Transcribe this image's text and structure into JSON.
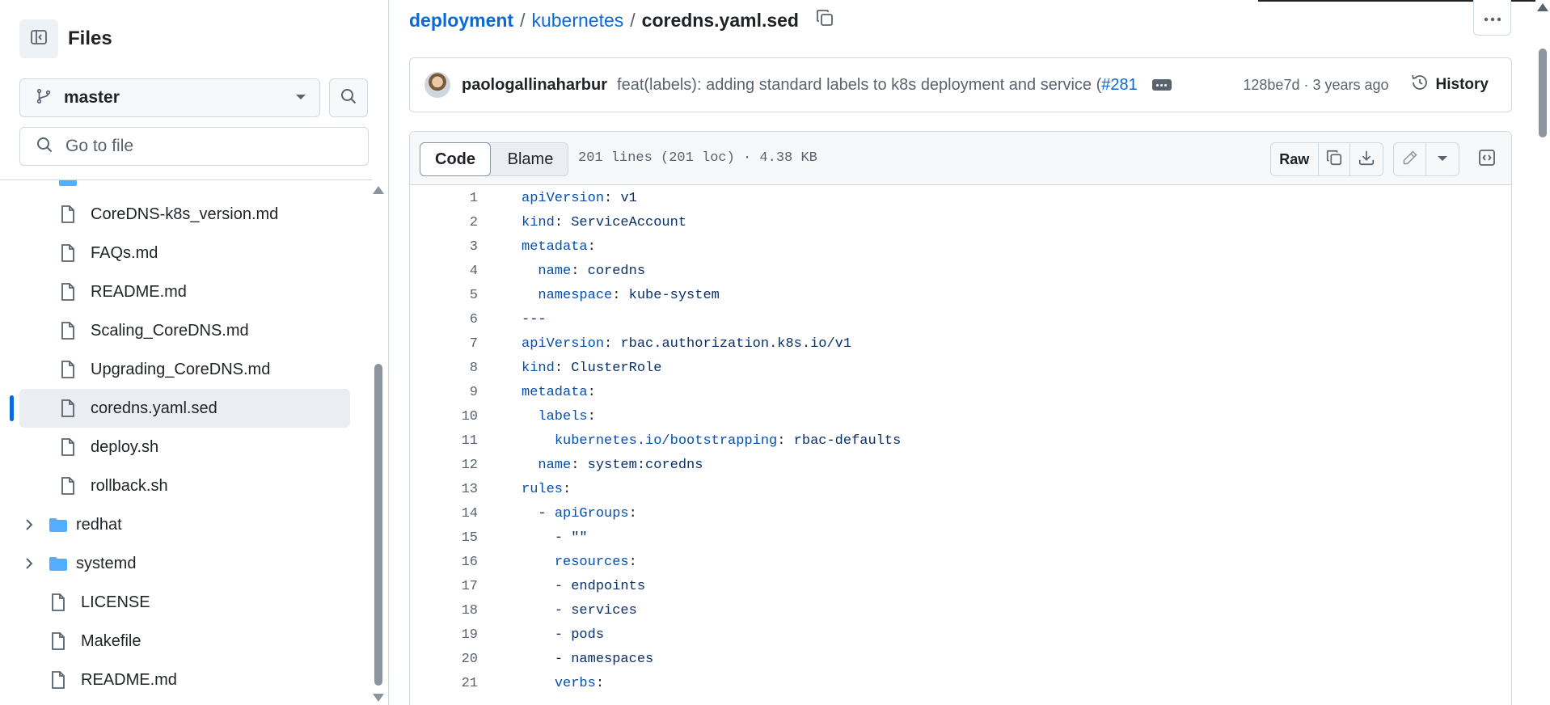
{
  "sidebar": {
    "title": "Files",
    "branch": "master",
    "goto_placeholder": "Go to file",
    "items": [
      {
        "label": "CoreDNS-k8s_version.md",
        "type": "file"
      },
      {
        "label": "FAQs.md",
        "type": "file"
      },
      {
        "label": "README.md",
        "type": "file"
      },
      {
        "label": "Scaling_CoreDNS.md",
        "type": "file"
      },
      {
        "label": "Upgrading_CoreDNS.md",
        "type": "file"
      },
      {
        "label": "coredns.yaml.sed",
        "type": "file",
        "active": true
      },
      {
        "label": "deploy.sh",
        "type": "file"
      },
      {
        "label": "rollback.sh",
        "type": "file"
      },
      {
        "label": "redhat",
        "type": "folder"
      },
      {
        "label": "systemd",
        "type": "folder"
      },
      {
        "label": "LICENSE",
        "type": "file"
      },
      {
        "label": "Makefile",
        "type": "file"
      },
      {
        "label": "README.md",
        "type": "file"
      }
    ]
  },
  "breadcrumb": {
    "root": "deployment",
    "sep": "/",
    "dir": "kubernetes",
    "file": "coredns.yaml.sed"
  },
  "commit": {
    "author": "paologallinaharbur",
    "message": "feat(labels): adding standard labels to k8s deployment and service (",
    "pr": "#281",
    "hash": "128be7d",
    "time": "3 years ago",
    "meta": "128be7d · 3 years ago",
    "history_label": "History"
  },
  "file": {
    "tab_code": "Code",
    "tab_blame": "Blame",
    "info": "201 lines (201 loc) · 4.38 KB",
    "raw_label": "Raw",
    "lines": [
      {
        "n": "1",
        "k": "apiVersion",
        "v": "v1",
        "indent": ""
      },
      {
        "n": "2",
        "k": "kind",
        "v": "ServiceAccount",
        "indent": ""
      },
      {
        "n": "3",
        "k": "metadata",
        "v": "",
        "indent": ""
      },
      {
        "n": "4",
        "k": "name",
        "v": "coredns",
        "indent": "  "
      },
      {
        "n": "5",
        "k": "namespace",
        "v": "kube-system",
        "indent": "  "
      },
      {
        "n": "6",
        "k": "",
        "v": "---",
        "indent": ""
      },
      {
        "n": "7",
        "k": "apiVersion",
        "v": "rbac.authorization.k8s.io/v1",
        "indent": ""
      },
      {
        "n": "8",
        "k": "kind",
        "v": "ClusterRole",
        "indent": ""
      },
      {
        "n": "9",
        "k": "metadata",
        "v": "",
        "indent": ""
      },
      {
        "n": "10",
        "k": "labels",
        "v": "",
        "indent": "  "
      },
      {
        "n": "11",
        "k": "kubernetes.io/bootstrapping",
        "v": "rbac-defaults",
        "indent": "    "
      },
      {
        "n": "12",
        "k": "name",
        "v": "system:coredns",
        "indent": "  "
      },
      {
        "n": "13",
        "k": "rules",
        "v": "",
        "indent": ""
      },
      {
        "n": "14",
        "k": "apiGroups",
        "v": "",
        "indent": "  - "
      },
      {
        "n": "15",
        "k": "",
        "v": "- \"\"",
        "indent": "    "
      },
      {
        "n": "16",
        "k": "resources",
        "v": "",
        "indent": "    "
      },
      {
        "n": "17",
        "k": "",
        "v": "- endpoints",
        "indent": "    "
      },
      {
        "n": "18",
        "k": "",
        "v": "- services",
        "indent": "    "
      },
      {
        "n": "19",
        "k": "",
        "v": "- pods",
        "indent": "    "
      },
      {
        "n": "20",
        "k": "",
        "v": "- namespaces",
        "indent": "    "
      },
      {
        "n": "21",
        "k": "verbs",
        "v": "",
        "indent": "    "
      }
    ]
  },
  "colors": {
    "link": "#0969da",
    "key": "#0550ae",
    "value": "#0a3069",
    "active_bar": "#0969da",
    "folder": "#54aeff"
  },
  "icons": [
    "sidebar-collapse-icon",
    "branch-icon",
    "chevron-down-icon",
    "search-icon",
    "file-icon",
    "folder-icon",
    "chevron-right-icon",
    "copy-icon",
    "kebab-horizontal-icon",
    "history-icon",
    "download-icon",
    "pencil-icon",
    "symbols-icon"
  ]
}
